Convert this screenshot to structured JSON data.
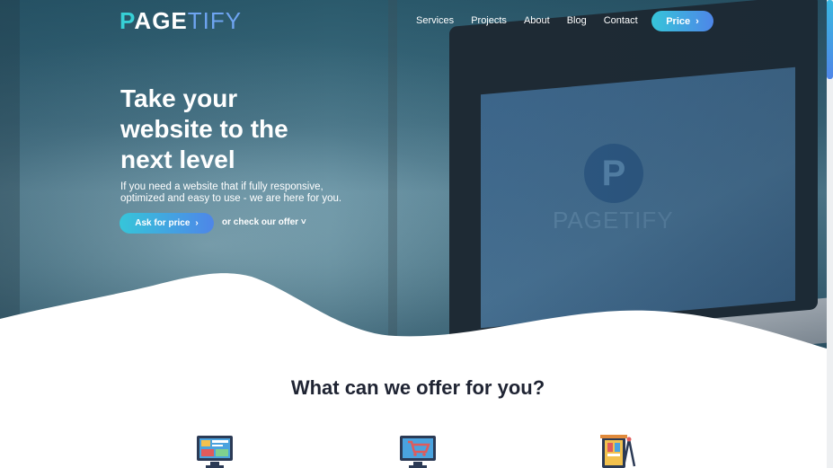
{
  "header": {
    "logo": {
      "part1": "P",
      "part2": "AGE",
      "part3": "TIFY"
    },
    "nav": [
      "Services",
      "Projects",
      "About",
      "Blog",
      "Contact"
    ],
    "price_button": "Price",
    "chevron": "›"
  },
  "hero": {
    "title_line1": "Take your",
    "title_line2": "website to the",
    "title_line3": "next level",
    "subtitle_line1": "If you need a website that if fully responsive,",
    "subtitle_line2": "optimized and easy to use - we are here for you.",
    "cta_button": "Ask for price",
    "secondary_link": "or check our offer",
    "secondary_caret": "˅",
    "screen_logo_letter": "P",
    "screen_logo_word": "PAGETIFY"
  },
  "offer": {
    "title": "What can we offer for you?",
    "icons": [
      "web-design-icon",
      "ecommerce-icon",
      "design-tools-icon"
    ]
  },
  "colors": {
    "accent_start": "#36c5d9",
    "accent_end": "#4e86e8",
    "heading": "#1f2433"
  }
}
